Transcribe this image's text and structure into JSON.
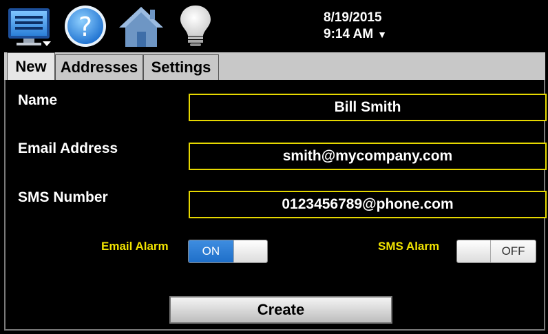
{
  "toolbar": {
    "icons": [
      "monitor-menu-icon",
      "help-icon",
      "home-icon",
      "lightbulb-icon"
    ],
    "date": "8/19/2015",
    "time": "9:14 AM",
    "time_caret": "▼"
  },
  "tabs": [
    {
      "label": "New",
      "active": true
    },
    {
      "label": "Addresses",
      "active": false
    },
    {
      "label": "Settings",
      "active": false
    }
  ],
  "form": {
    "name_label": "Name",
    "name_value": "Bill Smith",
    "email_label": "Email Address",
    "email_value": "smith@mycompany.com",
    "sms_label": "SMS Number",
    "sms_value": "0123456789@phone.com"
  },
  "alarms": {
    "email_alarm_label": "Email Alarm",
    "email_alarm_state": "ON",
    "sms_alarm_label": "SMS Alarm",
    "sms_alarm_state": "OFF"
  },
  "actions": {
    "create_label": "Create"
  },
  "colors": {
    "field_border": "#e6d800",
    "alarm_label": "#f2e400",
    "toggle_on": "#2a7bd6"
  }
}
